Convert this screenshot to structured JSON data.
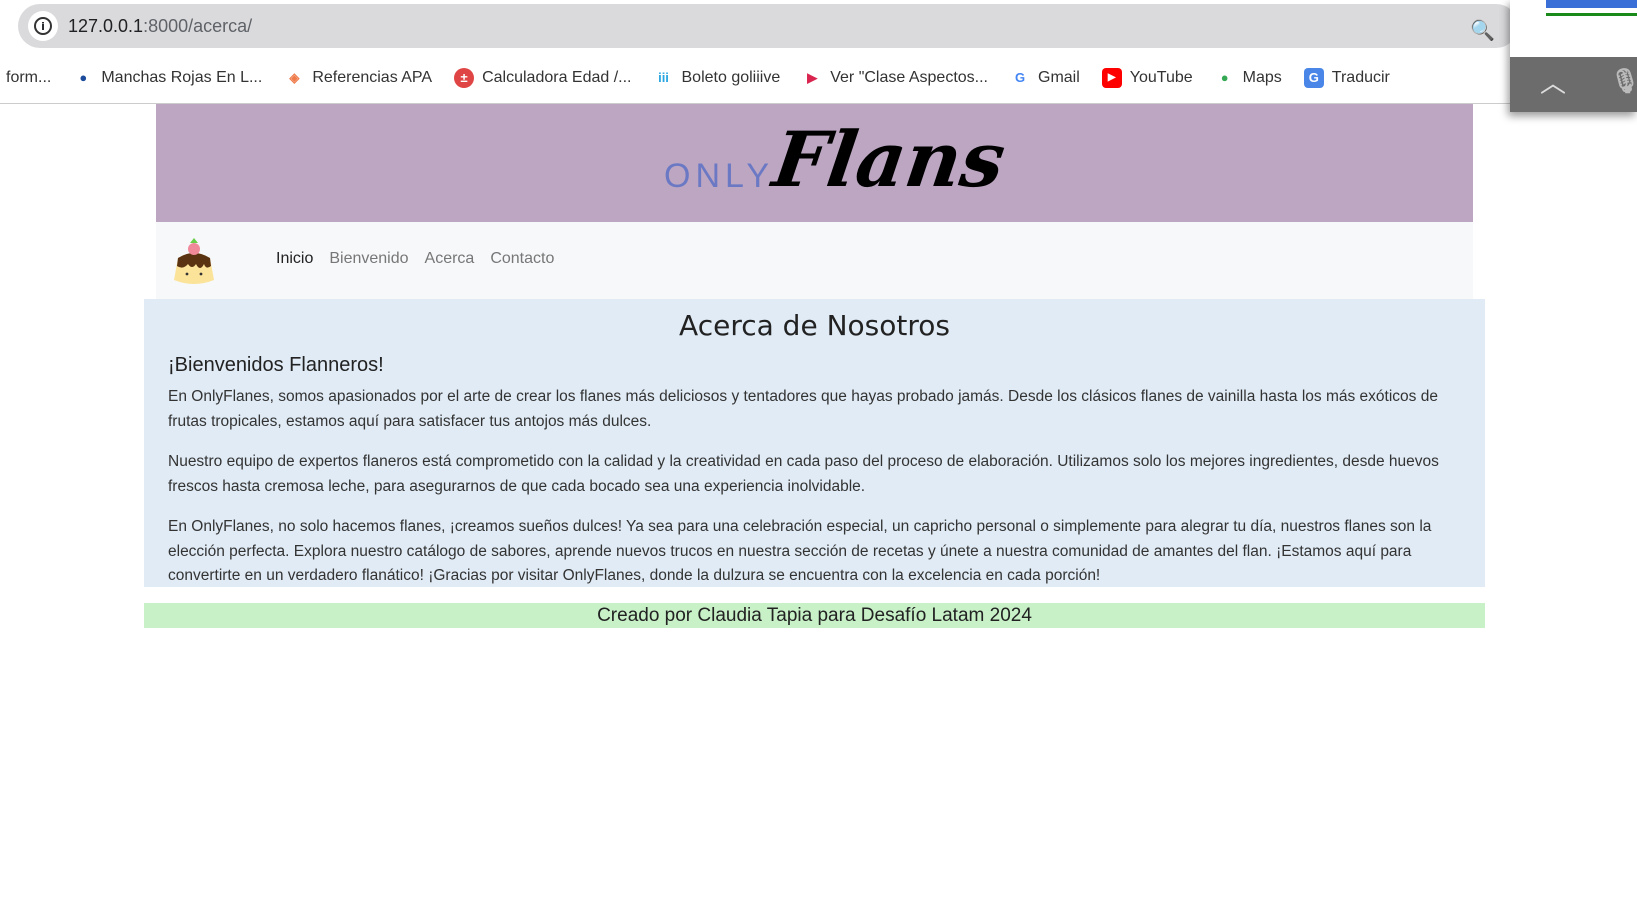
{
  "browser": {
    "url_host": "127.0.0.1",
    "url_path": ":8000/acerca/",
    "bookmarks": [
      {
        "label": "form...",
        "icon": ""
      },
      {
        "label": "Manchas Rojas En L...",
        "icon": "apple-icon"
      },
      {
        "label": "Referencias APA",
        "icon": "apa-icon"
      },
      {
        "label": "Calculadora Edad /...",
        "icon": "calculator-icon"
      },
      {
        "label": "Boleto goliiive",
        "icon": "goliiive-icon"
      },
      {
        "label": "Ver \"Clase Aspectos...",
        "icon": "play-icon"
      },
      {
        "label": "Gmail",
        "icon": "google-icon"
      },
      {
        "label": "YouTube",
        "icon": "youtube-icon"
      },
      {
        "label": "Maps",
        "icon": "maps-icon"
      },
      {
        "label": "Traducir",
        "icon": "translate-icon"
      }
    ]
  },
  "site": {
    "logo_only": "ONLY",
    "logo_flans": "Flans",
    "nav": [
      "Inicio",
      "Bienvenido",
      "Acerca",
      "Contacto"
    ]
  },
  "page": {
    "title": "Acerca de Nosotros",
    "subtitle": "¡Bienvenidos Flanneros!",
    "paragraphs": [
      "En OnlyFlanes, somos apasionados por el arte de crear los flanes más deliciosos y tentadores que hayas probado jamás. Desde los clásicos flanes de vainilla hasta los más exóticos de frutas tropicales, estamos aquí para satisfacer tus antojos más dulces.",
      "Nuestro equipo de expertos flaneros está comprometido con la calidad y la creatividad en cada paso del proceso de elaboración. Utilizamos solo los mejores ingredientes, desde huevos frescos hasta cremosa leche, para asegurarnos de que cada bocado sea una experiencia inolvidable.",
      "En OnlyFlanes, no solo hacemos flanes, ¡creamos sueños dulces! Ya sea para una celebración especial, un capricho personal o simplemente para alegrar tu día, nuestros flanes son la elección perfecta. Explora nuestro catálogo de sabores, aprende nuevos trucos en nuestra sección de recetas y únete a nuestra comunidad de amantes del flan. ¡Estamos aquí para convertirte en un verdadero flanático! ¡Gracias por visitar OnlyFlanes, donde la dulzura se encuentra con la excelencia en cada porción!"
    ],
    "footer": "Creado por Claudia Tapia para Desafío Latam 2024"
  }
}
